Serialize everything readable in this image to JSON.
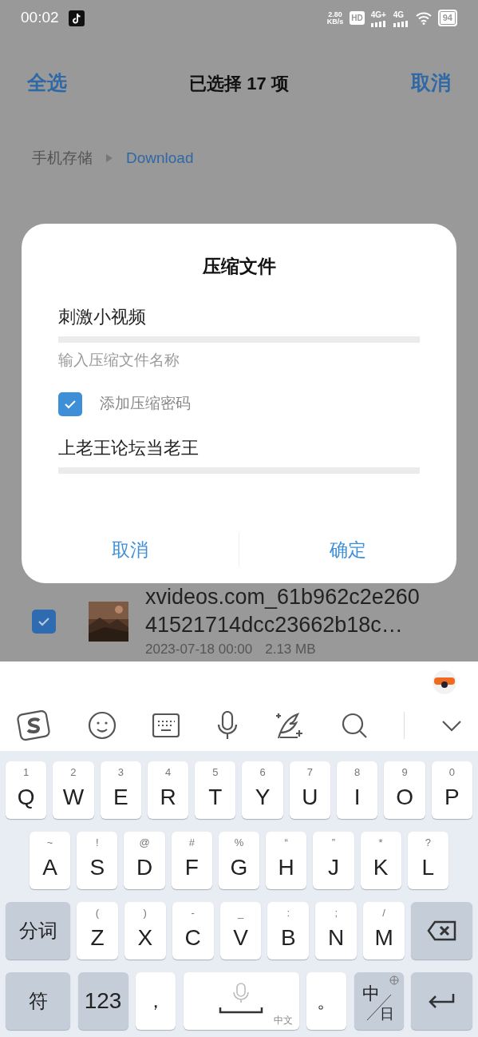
{
  "status_bar": {
    "time": "00:02",
    "net_speed": "2.80",
    "net_unit": "KB/s",
    "hd": "HD",
    "sim_1": "4G+",
    "sim_2": "4G",
    "battery": "94"
  },
  "header": {
    "left": "全选",
    "title": "已选择 17 项",
    "right": "取消"
  },
  "breadcrumb": [
    {
      "label": "手机存储",
      "current": false
    },
    {
      "label": "Download",
      "current": true
    }
  ],
  "files": [
    {
      "name": "xvideos.com_61b962c2e26041521714dcc23662b18c…",
      "date": "2023-07-18 00:00",
      "size": "2.13 MB",
      "checked": true,
      "kind": "picture"
    }
  ],
  "dialog": {
    "title": "压缩文件",
    "name_value": "刺激小视频",
    "name_hint": "输入压缩文件名称",
    "password_enabled": true,
    "password_label": "添加压缩密码",
    "password_value": "上老王论坛当老王",
    "buttons": [
      "取消",
      "确定"
    ]
  },
  "keyboard": {
    "key_rows": [
      {
        "keys": [
          {
            "kind": "letter",
            "hint": "1",
            "label": "Q"
          },
          {
            "kind": "letter",
            "hint": "2",
            "label": "W"
          },
          {
            "kind": "letter",
            "hint": "3",
            "label": "E"
          },
          {
            "kind": "letter",
            "hint": "4",
            "label": "R"
          },
          {
            "kind": "letter",
            "hint": "5",
            "label": "T"
          },
          {
            "kind": "letter",
            "hint": "6",
            "label": "Y"
          },
          {
            "kind": "letter",
            "hint": "7",
            "label": "U"
          },
          {
            "kind": "letter",
            "hint": "8",
            "label": "I"
          },
          {
            "kind": "letter",
            "hint": "9",
            "label": "O"
          },
          {
            "kind": "letter",
            "hint": "0",
            "label": "P"
          }
        ]
      },
      {
        "keys": [
          {
            "kind": "letter",
            "hint": "~",
            "label": "A"
          },
          {
            "kind": "letter",
            "hint": "!",
            "label": "S"
          },
          {
            "kind": "letter",
            "hint": "@",
            "label": "D"
          },
          {
            "kind": "letter",
            "hint": "#",
            "label": "F"
          },
          {
            "kind": "letter",
            "hint": "%",
            "label": "G"
          },
          {
            "kind": "letter",
            "hint": "“",
            "label": "H"
          },
          {
            "kind": "letter",
            "hint": "”",
            "label": "J"
          },
          {
            "kind": "letter",
            "hint": "*",
            "label": "K"
          },
          {
            "kind": "letter",
            "hint": "?",
            "label": "L"
          }
        ]
      },
      {
        "keys": [
          {
            "kind": "function",
            "label": "分词"
          },
          {
            "kind": "letter",
            "hint": "(",
            "label": "Z"
          },
          {
            "kind": "letter",
            "hint": ")",
            "label": "X"
          },
          {
            "kind": "letter",
            "hint": "-",
            "label": "C"
          },
          {
            "kind": "letter",
            "hint": "_",
            "label": "V"
          },
          {
            "kind": "letter",
            "hint": ":",
            "label": "B"
          },
          {
            "kind": "letter",
            "hint": ";",
            "label": "N"
          },
          {
            "kind": "letter",
            "hint": "/",
            "label": "M"
          },
          {
            "kind": "backspace"
          }
        ]
      },
      {
        "keys": [
          {
            "kind": "function",
            "label": "符"
          },
          {
            "kind": "function",
            "label": "123"
          },
          {
            "kind": "punct",
            "label": "，"
          },
          {
            "kind": "space",
            "sub": "中文"
          },
          {
            "kind": "punct",
            "label": "。"
          },
          {
            "kind": "lang",
            "label": "中",
            "sub": "日"
          },
          {
            "kind": "enter"
          }
        ]
      }
    ]
  }
}
